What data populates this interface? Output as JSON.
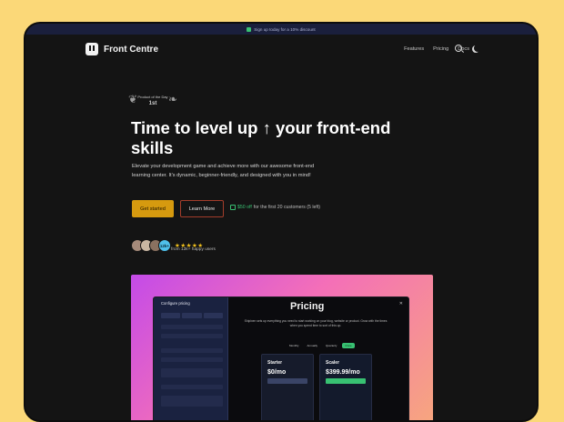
{
  "topbar": {
    "text": "Sign up today for a 10% discount"
  },
  "brand": {
    "name": "Front Centre"
  },
  "nav": {
    "links": [
      "Features",
      "Pricing",
      "Docs"
    ]
  },
  "badge": {
    "line1": "Product of the Day",
    "line2": "1st"
  },
  "hero": {
    "headline": "Time to level up ↑ your front-end skills",
    "subtitle": "Elevate your development game and achieve more with our awesome front-end learning center. It's dynamic, beginner-friendly, and designed with you in mind!"
  },
  "cta": {
    "primary": "Get started",
    "secondary": "Learn More",
    "promo_offer": "$50 off",
    "promo_rest": "for the first 20 customers (5 left)"
  },
  "social": {
    "count": "12k+",
    "stars": "★★★★★",
    "rating": 5,
    "happy": "from 12k+ happy users"
  },
  "preview": {
    "panel_title": "Configure pricing",
    "pricing_title": "Pricing",
    "pricing_subtitle": "Shipixen sets up everything you need to start working on your blog, website or product. Grow with the times when you spend time to sort of this up.",
    "toggle": [
      "Monthly",
      "Annually",
      "Quarterly",
      "Once"
    ],
    "plans": [
      {
        "name": "Starter",
        "price": "$0/mo"
      },
      {
        "name": "Scaler",
        "price": "$399.99/mo"
      }
    ]
  },
  "colors": {
    "accent": "#d69a0f",
    "background": "#141414",
    "page": "#fbd878",
    "success": "#38c172"
  }
}
